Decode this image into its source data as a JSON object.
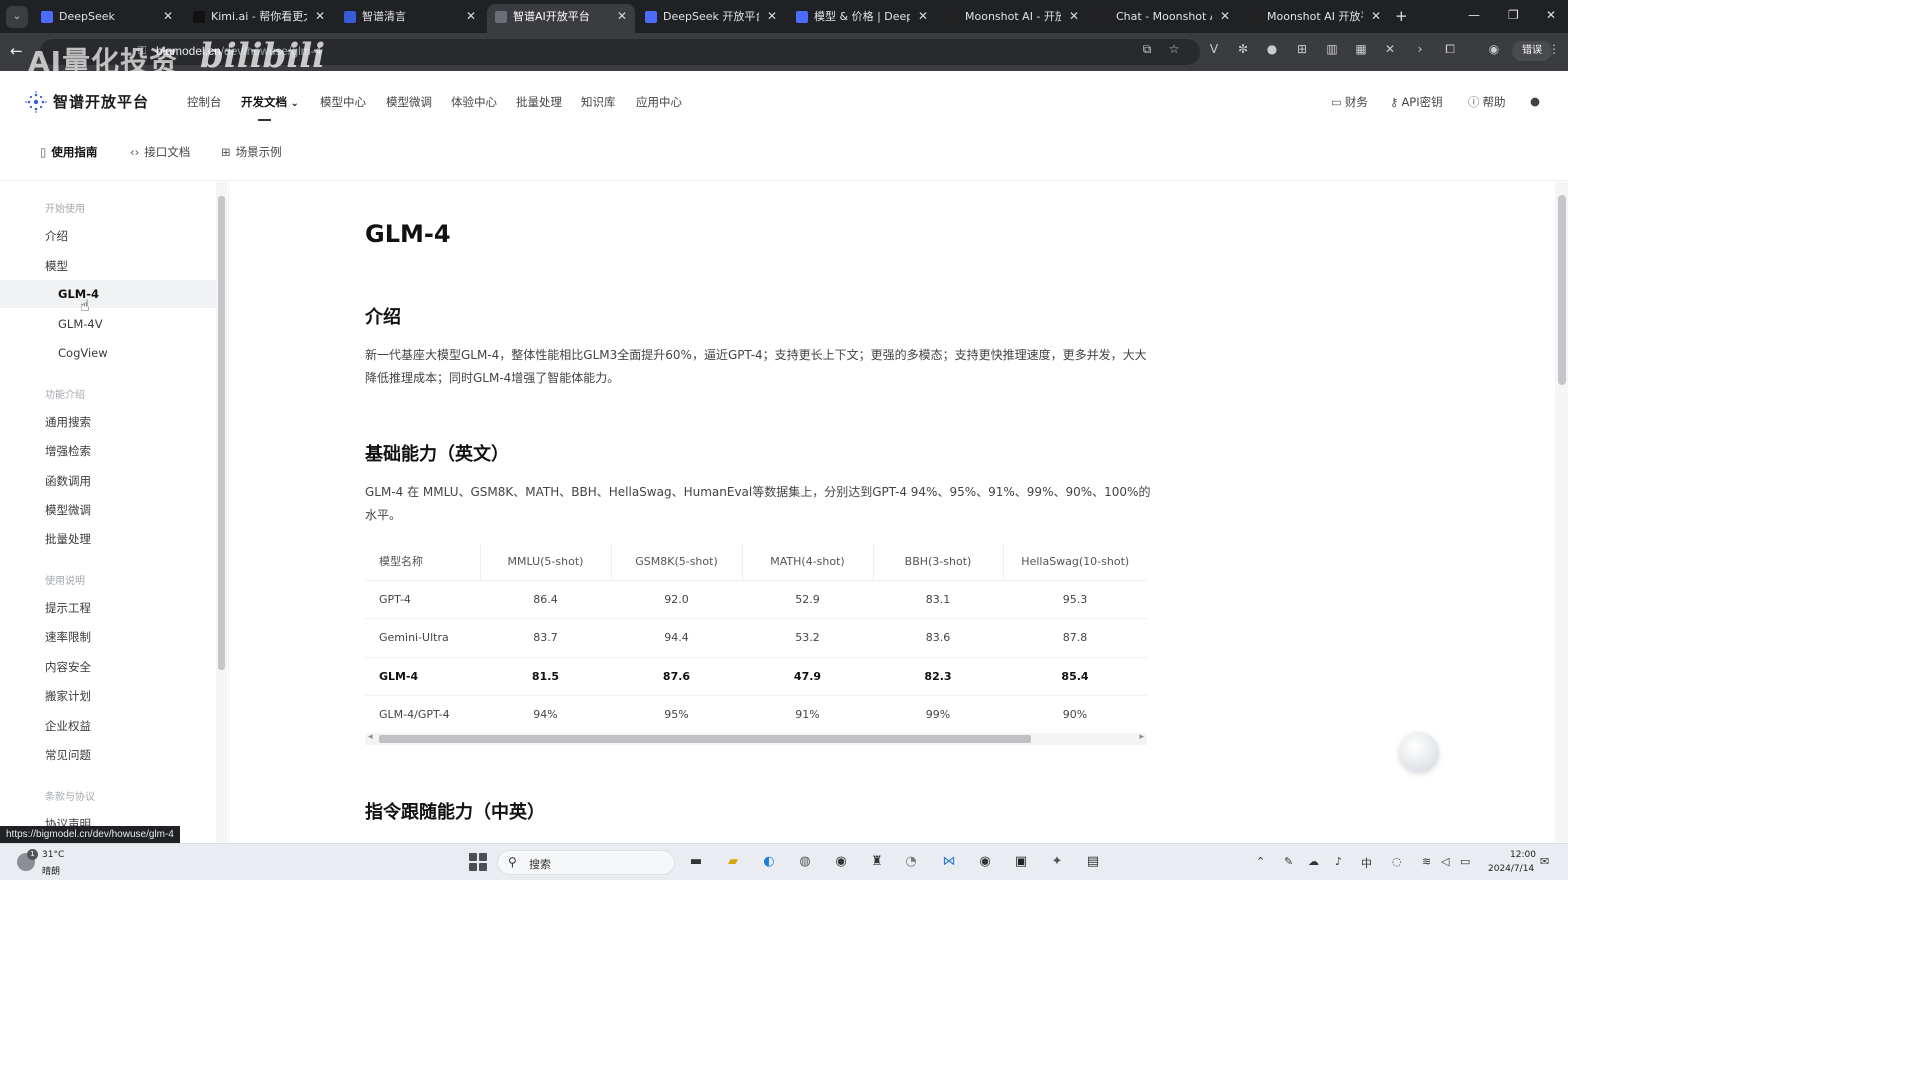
{
  "browser": {
    "tabs": [
      {
        "label": "DeepSeek",
        "icon": "deepseek-icon",
        "active": false
      },
      {
        "label": "Kimi.ai - 帮你看更大",
        "icon": "kimi-icon",
        "active": false
      },
      {
        "label": "智谱清言",
        "icon": "zhipu-qingyan-icon",
        "active": false
      },
      {
        "label": "智谱AI开放平台",
        "icon": "zhipu-open-icon",
        "active": true
      },
      {
        "label": "DeepSeek 开放平台",
        "icon": "deepseek-icon",
        "active": false
      },
      {
        "label": "模型 & 价格 | DeepS",
        "icon": "deepseek-icon",
        "active": false
      },
      {
        "label": "Moonshot AI - 开放",
        "icon": "moonshot-icon",
        "active": false
      },
      {
        "label": "Chat - Moonshot AI",
        "icon": "moonshot-icon",
        "active": false
      },
      {
        "label": "Moonshot AI 开放平",
        "icon": "moonshot-icon",
        "active": false
      }
    ],
    "url_host": "bigmodel.cn",
    "url_path": "/dev/howuse/glm-4",
    "error_button": "错误",
    "watermark_text": "AI量化投资",
    "watermark_brand": "bilibili",
    "status_url": "https://bigmodel.cn/dev/howuse/glm-4"
  },
  "header": {
    "logo_text": "智谱开放平台",
    "nav": [
      "控制台",
      "开发文档",
      "模型中心",
      "模型微调",
      "体验中心",
      "批量处理",
      "知识库",
      "应用中心"
    ],
    "nav_active_index": 1,
    "right": {
      "finance": "财务",
      "api_keys": "API密钥",
      "help": "帮助"
    }
  },
  "subnav": {
    "items": [
      "使用指南",
      "接口文档",
      "场景示例"
    ],
    "active_index": 0
  },
  "sidebar": {
    "group_start": "开始使用",
    "intro": "介绍",
    "models": "模型",
    "model_items": [
      "GLM-4",
      "GLM-4V",
      "CogView"
    ],
    "active_model_index": 0,
    "group_features": "功能介绍",
    "feature_items": [
      "通用搜索",
      "增强检索",
      "函数调用",
      "模型微调",
      "批量处理"
    ],
    "group_usage": "使用说明",
    "usage_items": [
      "提示工程",
      "速率限制",
      "内容安全",
      "搬家计划",
      "企业权益",
      "常见问题"
    ],
    "group_terms": "条款与协议",
    "terms_items": [
      "协议声明"
    ]
  },
  "content": {
    "title": "GLM-4",
    "intro_heading": "介绍",
    "intro_text": "新一代基座大模型GLM-4，整体性能相比GLM3全面提升60%，逼近GPT-4；支持更长上下文；更强的多模态；支持更快推理速度，更多并发，大大降低推理成本；同时GLM-4增强了智能体能力。",
    "base_heading": "基础能力（英文）",
    "base_text": "GLM-4 在 MMLU、GSM8K、MATH、BBH、HellaSwag、HumanEval等数据集上，分别达到GPT-4 94%、95%、91%、99%、90%、100%的水平。",
    "table": {
      "headers": [
        "模型名称",
        "MMLU(5-shot)",
        "GSM8K(5-shot)",
        "MATH(4-shot)",
        "BBH(3-shot)",
        "HellaSwag(10-shot)"
      ],
      "rows": [
        [
          "GPT-4",
          "86.4",
          "92.0",
          "52.9",
          "83.1",
          "95.3"
        ],
        [
          "Gemini-Ultra",
          "83.7",
          "94.4",
          "53.2",
          "83.6",
          "87.8"
        ],
        [
          "GLM-4",
          "81.5",
          "87.6",
          "47.9",
          "82.3",
          "85.4"
        ],
        [
          "GLM-4/GPT-4",
          "94%",
          "95%",
          "91%",
          "99%",
          "90%"
        ]
      ],
      "highlight_row": 2
    },
    "next_heading": "指令跟随能力（中英）"
  },
  "taskbar": {
    "weather_temp": "31°C",
    "weather_desc": "晴朗",
    "weather_badge": "1",
    "search_placeholder": "搜索",
    "ime": "中",
    "time": "12:00",
    "date": "2024/7/14"
  }
}
